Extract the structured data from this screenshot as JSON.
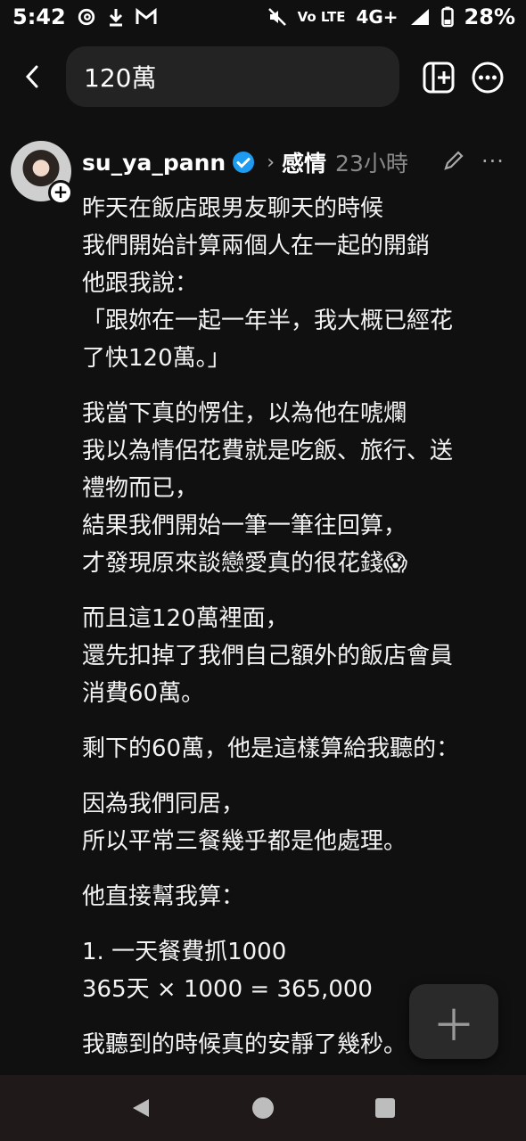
{
  "status_bar": {
    "time": "5:42",
    "network": "4G+",
    "volte": "Vo LTE",
    "battery": "28%"
  },
  "search": {
    "query": "120萬"
  },
  "post": {
    "username": "su_ya_pann",
    "topic": "感情",
    "time": "23小時",
    "paragraphs": [
      [
        "昨天在飯店跟男友聊天的時候",
        "我們開始計算兩個人在一起的開銷",
        "他跟我說：",
        "「跟妳在一起一年半，我大概已經花",
        "了快120萬。」"
      ],
      [
        "我當下真的愣住，以為他在唬爛",
        "我以為情侶花費就是吃飯、旅行、送",
        "禮物而已，",
        "結果我們開始一筆一筆往回算，",
        "才發現原來談戀愛真的很花錢😱"
      ],
      [
        "而且這120萬裡面，",
        "還先扣掉了我們自己額外的飯店會員",
        "消費60萬。"
      ],
      [
        "剩下的60萬，他是這樣算給我聽的："
      ],
      [
        "因為我們同居，",
        "所以平常三餐幾乎都是他處理。"
      ],
      [
        "他直接幫我算："
      ],
      [
        "1. 一天餐費抓1000",
        "365天 × 1000 = 365,000"
      ],
      [
        "我聽到的時候真的安靜了幾秒。"
      ]
    ]
  },
  "icons": {
    "back": "back-arrow-icon",
    "add": "new-post-icon",
    "more": "more-options-icon",
    "verified": "verified-badge-icon",
    "edit": "pencil-icon",
    "fab": "plus-icon"
  }
}
